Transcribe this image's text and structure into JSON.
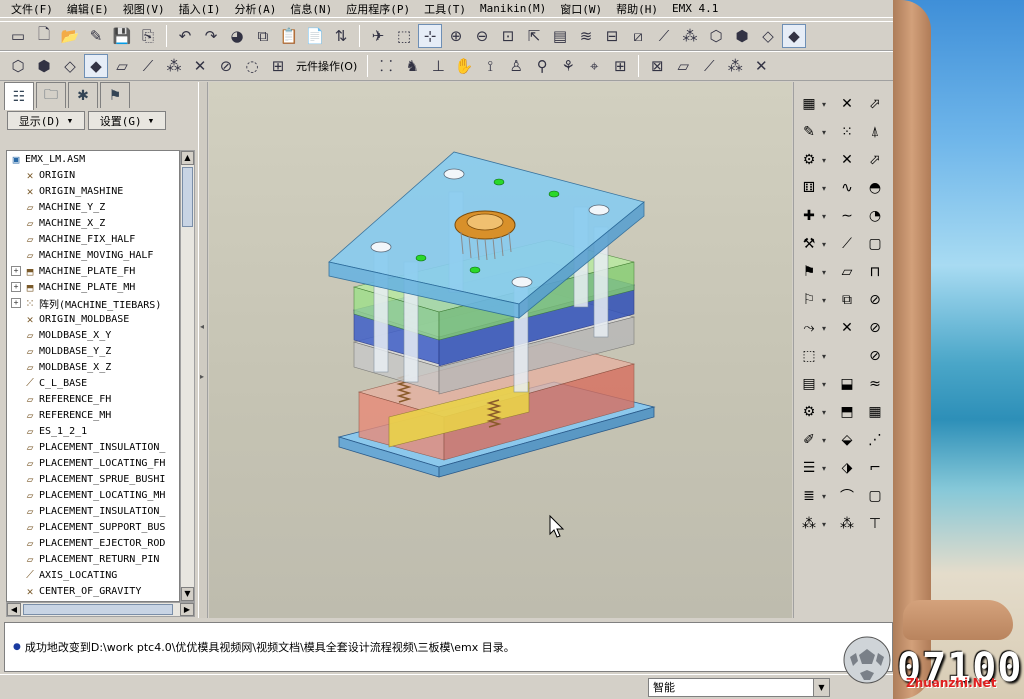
{
  "menubar": [
    "文件(F)",
    "编辑(E)",
    "视图(V)",
    "插入(I)",
    "分析(A)",
    "信息(N)",
    "应用程序(P)",
    "工具(T)",
    "Manikin(M)",
    "窗口(W)",
    "帮助(H)",
    "EMX 4.1"
  ],
  "toolbar2": {
    "component_ops": "元件操作(O)"
  },
  "panel": {
    "display_label": "显示(D)",
    "settings_label": "设置(G)"
  },
  "tree": [
    {
      "label": "EMX_LM.ASM",
      "icon": "assembly-icon",
      "expand": "",
      "indent": 0
    },
    {
      "label": "ORIGIN",
      "icon": "csys-icon",
      "expand": "",
      "indent": 1
    },
    {
      "label": "ORIGIN_MASHINE",
      "icon": "csys-icon",
      "expand": "",
      "indent": 1
    },
    {
      "label": "MACHINE_Y_Z",
      "icon": "datum-plane-icon",
      "expand": "",
      "indent": 1
    },
    {
      "label": "MACHINE_X_Z",
      "icon": "datum-plane-icon",
      "expand": "",
      "indent": 1
    },
    {
      "label": "MACHINE_FIX_HALF",
      "icon": "datum-plane-icon",
      "expand": "",
      "indent": 1
    },
    {
      "label": "MACHINE_MOVING_HALF",
      "icon": "datum-plane-icon",
      "expand": "",
      "indent": 1
    },
    {
      "label": "MACHINE_PLATE_FH",
      "icon": "part-icon",
      "expand": "+",
      "indent": 1
    },
    {
      "label": "MACHINE_PLATE_MH",
      "icon": "part-icon",
      "expand": "+",
      "indent": 1
    },
    {
      "label": "阵列(MACHINE_TIEBARS)",
      "icon": "pattern-icon",
      "expand": "+",
      "indent": 1
    },
    {
      "label": "ORIGIN_MOLDBASE",
      "icon": "csys-icon",
      "expand": "",
      "indent": 1
    },
    {
      "label": "MOLDBASE_X_Y",
      "icon": "datum-plane-icon",
      "expand": "",
      "indent": 1
    },
    {
      "label": "MOLDBASE_Y_Z",
      "icon": "datum-plane-icon",
      "expand": "",
      "indent": 1
    },
    {
      "label": "MOLDBASE_X_Z",
      "icon": "datum-plane-icon",
      "expand": "",
      "indent": 1
    },
    {
      "label": "C_L_BASE",
      "icon": "axis-icon",
      "expand": "",
      "indent": 1
    },
    {
      "label": "REFERENCE_FH",
      "icon": "datum-plane-icon",
      "expand": "",
      "indent": 1
    },
    {
      "label": "REFERENCE_MH",
      "icon": "datum-plane-icon",
      "expand": "",
      "indent": 1
    },
    {
      "label": "ES_1_2_1",
      "icon": "datum-plane-icon",
      "expand": "",
      "indent": 1
    },
    {
      "label": "PLACEMENT_INSULATION_",
      "icon": "datum-plane-icon",
      "expand": "",
      "indent": 1
    },
    {
      "label": "PLACEMENT_LOCATING_FH",
      "icon": "datum-plane-icon",
      "expand": "",
      "indent": 1
    },
    {
      "label": "PLACEMENT_SPRUE_BUSHI",
      "icon": "datum-plane-icon",
      "expand": "",
      "indent": 1
    },
    {
      "label": "PLACEMENT_LOCATING_MH",
      "icon": "datum-plane-icon",
      "expand": "",
      "indent": 1
    },
    {
      "label": "PLACEMENT_INSULATION_",
      "icon": "datum-plane-icon",
      "expand": "",
      "indent": 1
    },
    {
      "label": "PLACEMENT_SUPPORT_BUS",
      "icon": "datum-plane-icon",
      "expand": "",
      "indent": 1
    },
    {
      "label": "PLACEMENT_EJECTOR_ROD",
      "icon": "datum-plane-icon",
      "expand": "",
      "indent": 1
    },
    {
      "label": "PLACEMENT_RETURN_PIN",
      "icon": "datum-plane-icon",
      "expand": "",
      "indent": 1
    },
    {
      "label": "AXIS_LOCATING",
      "icon": "axis-icon",
      "expand": "",
      "indent": 1
    },
    {
      "label": "CENTER_OF_GRAVITY",
      "icon": "csys-icon",
      "expand": "",
      "indent": 1
    }
  ],
  "message": "成功地改变到D:\\work ptc4.0\\优优模具视频网\\视频文档\\模具全套设计流程视频\\三板模\\emx 目录。",
  "status": {
    "filter_value": "智能"
  },
  "watermark": {
    "number": "07100",
    "site": "Zhuanzhi.Net"
  },
  "colors": {
    "mold_top": "#7fc8f0",
    "mold_green": "#9ee08a",
    "mold_blue": "#3050c8",
    "mold_red": "#e07a6a",
    "mold_yellow": "#e8d04a",
    "ring": "#d8902a"
  }
}
